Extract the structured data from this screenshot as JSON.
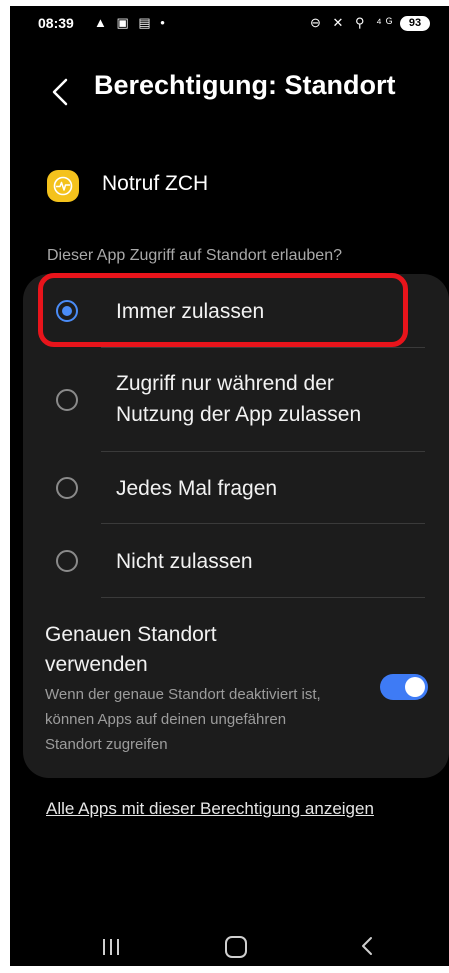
{
  "status_bar": {
    "time": "08:39",
    "left_icons": "▲ ▣ ▤ •",
    "right_icons": "⊖ ✕ ⚲ ⁴ᴳ ıll",
    "battery": "93"
  },
  "header": {
    "title": "Berechtigung: Standort"
  },
  "app": {
    "name": "Notruf ZCH",
    "icon_color": "#f4c21c"
  },
  "question": "Dieser App Zugriff auf Standort erlauben?",
  "options": [
    {
      "label": "Immer zulassen",
      "selected": true
    },
    {
      "label": "Zugriff nur während der Nutzung der App zulassen",
      "selected": false
    },
    {
      "label": "Jedes Mal fragen",
      "selected": false
    },
    {
      "label": "Nicht zulassen",
      "selected": false
    }
  ],
  "precise_location": {
    "title": "Genauen Standort verwenden",
    "description": "Wenn der genaue Standort deaktiviert ist, können Apps auf deinen ungefähren Standort zugreifen",
    "enabled": true
  },
  "all_apps_link": "Alle Apps mit dieser Berechtigung anzeigen",
  "colors": {
    "accent": "#4a8cf7",
    "highlight": "#e8141b",
    "card": "#1c1c1c"
  }
}
